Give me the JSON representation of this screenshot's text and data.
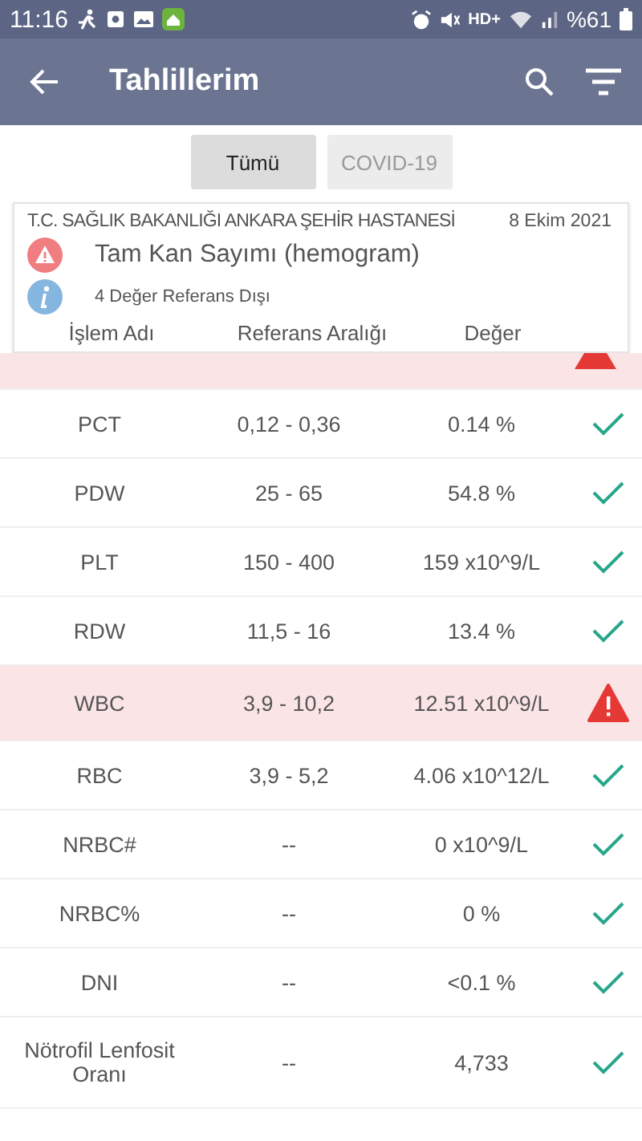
{
  "status_bar": {
    "time": "11:16",
    "battery": "%61",
    "network": "HD+"
  },
  "app_bar": {
    "title": "Tahlillerim"
  },
  "tabs": [
    {
      "label": "Tümü",
      "selected": true
    },
    {
      "label": "COVID-19",
      "selected": false
    }
  ],
  "card": {
    "hospital": "T.C. SAĞLIK BAKANLIĞI ANKARA ŞEHİR HASTANESİ",
    "date": "8 Ekim 2021",
    "test": "Tam Kan Sayımı (hemogram)",
    "info": "4 Değer Referans Dışı",
    "columns": [
      "İşlem Adı",
      "Referans Aralığı",
      "Değer"
    ]
  },
  "hidden_row": {
    "abnormal": true
  },
  "rows": [
    {
      "name": "PCT",
      "range": "0,12 - 0,36",
      "value": "0.14 %",
      "abnormal": false
    },
    {
      "name": "PDW",
      "range": "25 - 65",
      "value": "54.8 %",
      "abnormal": false
    },
    {
      "name": "PLT",
      "range": "150 - 400",
      "value": "159 x10^9/L",
      "abnormal": false
    },
    {
      "name": "RDW",
      "range": "11,5 - 16",
      "value": "13.4 %",
      "abnormal": false
    },
    {
      "name": "WBC",
      "range": "3,9 - 10,2",
      "value": "12.51 x10^9/L",
      "abnormal": true
    },
    {
      "name": "RBC",
      "range": "3,9 - 5,2",
      "value": "4.06 x10^12/L",
      "abnormal": false
    },
    {
      "name": "NRBC#",
      "range": "--",
      "value": "0 x10^9/L",
      "abnormal": false
    },
    {
      "name": "NRBC%",
      "range": "--",
      "value": "0 %",
      "abnormal": false
    },
    {
      "name": "DNI",
      "range": "--",
      "value": "<0.1 %",
      "abnormal": false
    },
    {
      "name": "Nötrofil Lenfosit Oranı",
      "range": "--",
      "value": "4,733",
      "abnormal": false
    }
  ]
}
